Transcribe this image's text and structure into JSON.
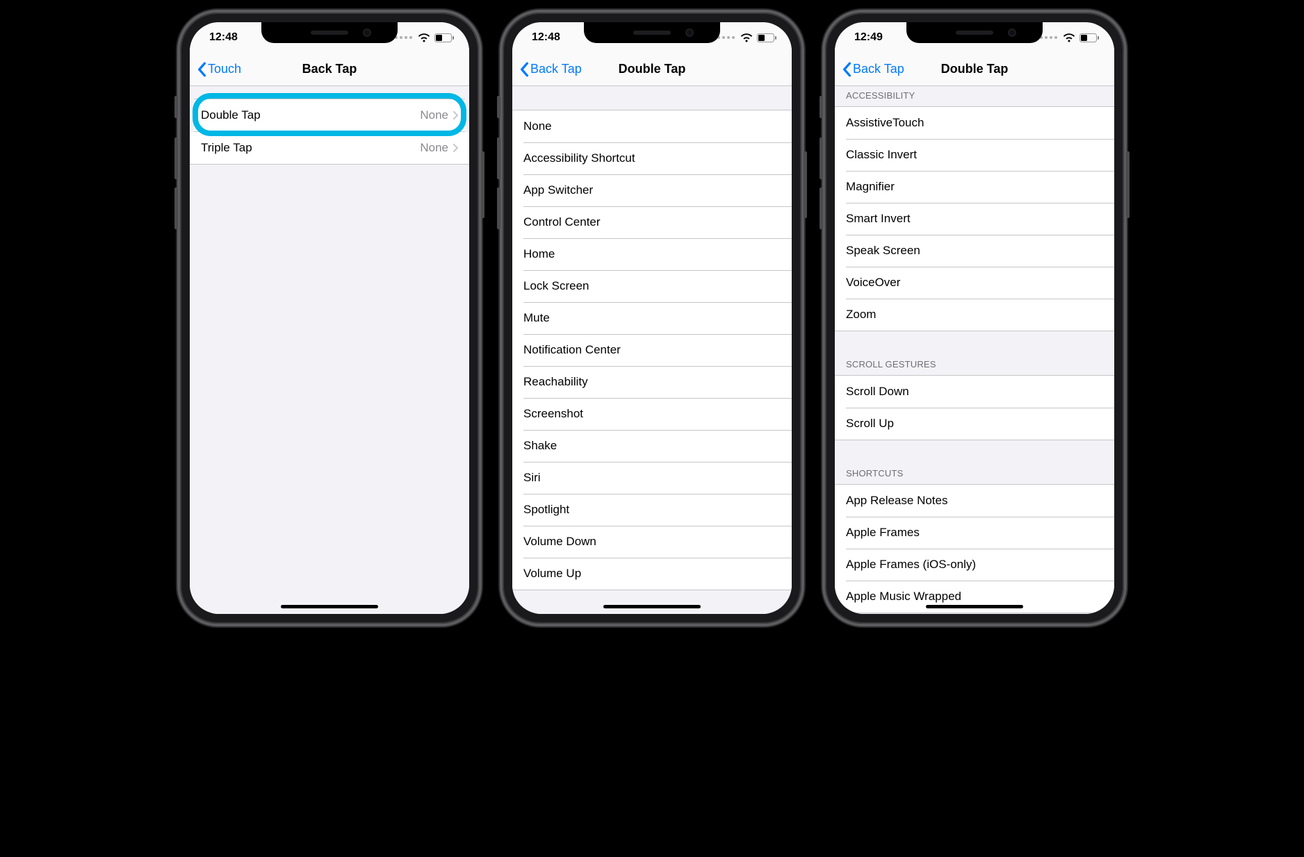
{
  "screens": [
    {
      "statusbar": {
        "time": "12:48"
      },
      "nav": {
        "back": "Touch",
        "title": "Back Tap"
      },
      "groups": [
        {
          "header": "",
          "rows": [
            {
              "label": "Double Tap",
              "value": "None",
              "disclosure": true,
              "highlighted": true
            },
            {
              "label": "Triple Tap",
              "value": "None",
              "disclosure": true
            }
          ]
        }
      ]
    },
    {
      "statusbar": {
        "time": "12:48"
      },
      "nav": {
        "back": "Back Tap",
        "title": "Double Tap"
      },
      "groups": [
        {
          "header": "",
          "rows": [
            {
              "label": "None"
            },
            {
              "label": "Accessibility Shortcut"
            },
            {
              "label": "App Switcher"
            },
            {
              "label": "Control Center"
            },
            {
              "label": "Home"
            },
            {
              "label": "Lock Screen"
            },
            {
              "label": "Mute"
            },
            {
              "label": "Notification Center"
            },
            {
              "label": "Reachability"
            },
            {
              "label": "Screenshot"
            },
            {
              "label": "Shake"
            },
            {
              "label": "Siri"
            },
            {
              "label": "Spotlight"
            },
            {
              "label": "Volume Down"
            },
            {
              "label": "Volume Up"
            }
          ]
        }
      ]
    },
    {
      "statusbar": {
        "time": "12:49"
      },
      "nav": {
        "back": "Back Tap",
        "title": "Double Tap"
      },
      "groups": [
        {
          "header": "Accessibility",
          "rows": [
            {
              "label": "AssistiveTouch"
            },
            {
              "label": "Classic Invert"
            },
            {
              "label": "Magnifier"
            },
            {
              "label": "Smart Invert"
            },
            {
              "label": "Speak Screen"
            },
            {
              "label": "VoiceOver"
            },
            {
              "label": "Zoom"
            }
          ]
        },
        {
          "header": "Scroll Gestures",
          "rows": [
            {
              "label": "Scroll Down"
            },
            {
              "label": "Scroll Up"
            }
          ]
        },
        {
          "header": "Shortcuts",
          "rows": [
            {
              "label": "App Release Notes"
            },
            {
              "label": "Apple Frames"
            },
            {
              "label": "Apple Frames (iOS-only)"
            },
            {
              "label": "Apple Music Wrapped"
            }
          ]
        }
      ]
    }
  ]
}
